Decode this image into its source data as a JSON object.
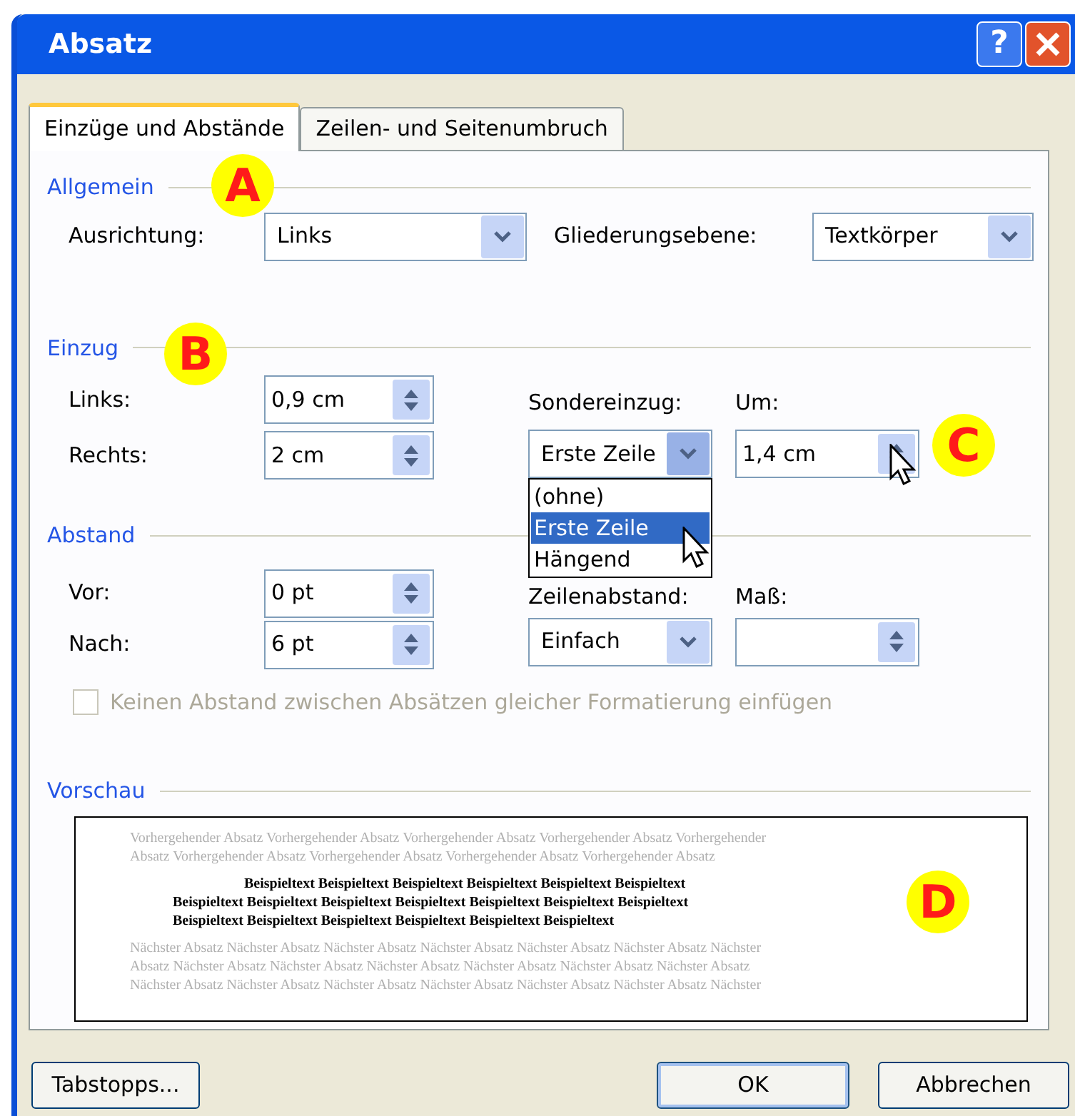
{
  "window": {
    "title": "Absatz"
  },
  "title_buttons": [
    {
      "kind": "help",
      "text": "?"
    },
    {
      "kind": "close"
    }
  ],
  "tabs": [
    {
      "label": "Einzüge und Abstände",
      "selected": true
    },
    {
      "label": "Zeilen- und Seitenumbruch",
      "selected": false
    }
  ],
  "general": {
    "heading": "Allgemein",
    "alignment": {
      "label": "Ausrichtung:",
      "value": "Links"
    },
    "outline_level": {
      "label": "Gliederungsebene:",
      "value": "Textkörper"
    }
  },
  "indent": {
    "heading": "Einzug",
    "left": {
      "label": "Links:",
      "value": "0,9 cm"
    },
    "right": {
      "label": "Rechts:",
      "value": "2 cm"
    },
    "special": {
      "label": "Sondereinzug:",
      "value": "Erste Zeile",
      "expanded": true,
      "options": [
        {
          "label": "(ohne)",
          "selected": false
        },
        {
          "label": "Erste Zeile",
          "selected": true
        },
        {
          "label": "Hängend",
          "selected": false
        }
      ]
    },
    "by": {
      "label": "Um:",
      "value": "1,4 cm"
    }
  },
  "spacing": {
    "heading": "Abstand",
    "before": {
      "label": "Vor:",
      "value": "0 pt"
    },
    "after": {
      "label": "Nach:",
      "value": "6 pt"
    },
    "line_spacing": {
      "label": "Zeilenabstand:",
      "value": "Einfach"
    },
    "at": {
      "label": "Maß:"
    }
  },
  "no_space_checkbox": {
    "label": "Keinen Abstand zwischen Absätzen gleicher Formatierung einfügen",
    "checked": false,
    "disabled": true
  },
  "preview": {
    "heading": "Vorschau",
    "previous_lines": [
      "Vorhergehender Absatz Vorhergehender Absatz Vorhergehender Absatz Vorhergehender Absatz Vorhergehender",
      "Absatz Vorhergehender Absatz Vorhergehender Absatz Vorhergehender Absatz Vorhergehender Absatz"
    ],
    "sample_lines": [
      "Beispieltext Beispieltext Beispieltext Beispieltext Beispieltext Beispieltext",
      "Beispieltext Beispieltext Beispieltext Beispieltext Beispieltext Beispieltext Beispieltext",
      "Beispieltext Beispieltext Beispieltext Beispieltext Beispieltext Beispieltext"
    ],
    "next_lines": [
      "Nächster Absatz Nächster Absatz Nächster Absatz Nächster Absatz Nächster Absatz Nächster Absatz Nächster",
      "Absatz Nächster Absatz Nächster Absatz Nächster Absatz Nächster Absatz Nächster Absatz Nächster Absatz",
      "Nächster Absatz Nächster Absatz Nächster Absatz Nächster Absatz Nächster Absatz Nächster Absatz Nächster"
    ]
  },
  "annotations": [
    {
      "text": "A"
    },
    {
      "text": "B"
    },
    {
      "text": "C"
    },
    {
      "text": "D"
    }
  ],
  "buttons": [
    {
      "label": "Tabstopps...",
      "default": false
    },
    {
      "label": "OK",
      "default": true
    },
    {
      "label": "Abbrechen",
      "default": false
    }
  ]
}
